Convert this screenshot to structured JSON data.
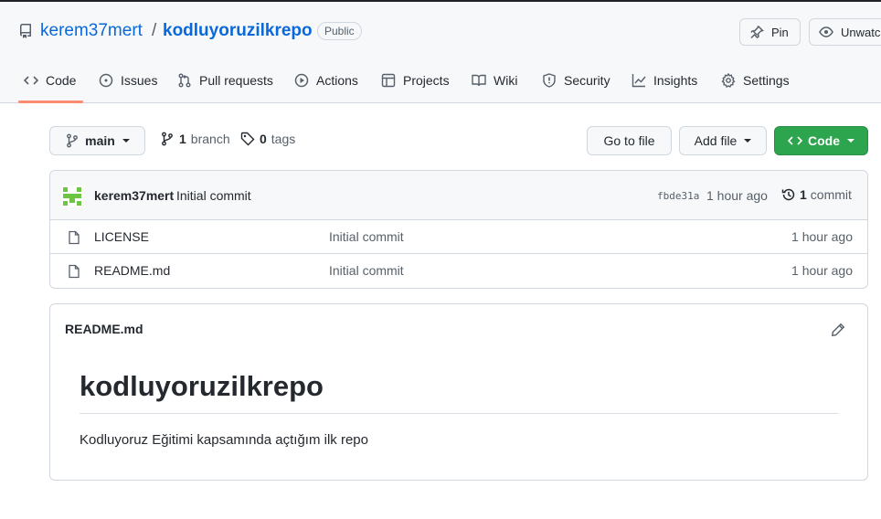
{
  "repo": {
    "owner": "kerem37mert",
    "separator": "/",
    "name": "kodluyoruzilkrepo",
    "visibility": "Public"
  },
  "header_buttons": {
    "pin_label": "Pin",
    "unwatch_label": "Unwatch"
  },
  "tabs": [
    {
      "label": "Code",
      "icon": "code-icon"
    },
    {
      "label": "Issues",
      "icon": "issue-icon"
    },
    {
      "label": "Pull requests",
      "icon": "pull-request-icon"
    },
    {
      "label": "Actions",
      "icon": "play-icon"
    },
    {
      "label": "Projects",
      "icon": "table-icon"
    },
    {
      "label": "Wiki",
      "icon": "book-icon"
    },
    {
      "label": "Security",
      "icon": "shield-icon"
    },
    {
      "label": "Insights",
      "icon": "graph-icon"
    },
    {
      "label": "Settings",
      "icon": "gear-icon"
    }
  ],
  "toolbar": {
    "branch": "main",
    "branch_count": "1",
    "branch_word": "branch",
    "tag_count": "0",
    "tag_word": "tags",
    "go_to_file": "Go to file",
    "add_file": "Add file",
    "code": "Code"
  },
  "latest_commit": {
    "author": "kerem37mert",
    "message": "Initial commit",
    "sha": "fbde31a",
    "time": "1 hour ago",
    "count": "1",
    "count_word": "commit"
  },
  "files": [
    {
      "name": "LICENSE",
      "commit": "Initial commit",
      "time": "1 hour ago"
    },
    {
      "name": "README.md",
      "commit": "Initial commit",
      "time": "1 hour ago"
    }
  ],
  "readme": {
    "filename": "README.md",
    "heading": "kodluyoruzilkrepo",
    "body": "Kodluyoruz Eğitimi kapsamında açtığım ilk repo"
  },
  "colors": {
    "link": "#0969da",
    "accent_tab": "#fd8c73",
    "green_button": "#2da44e"
  }
}
